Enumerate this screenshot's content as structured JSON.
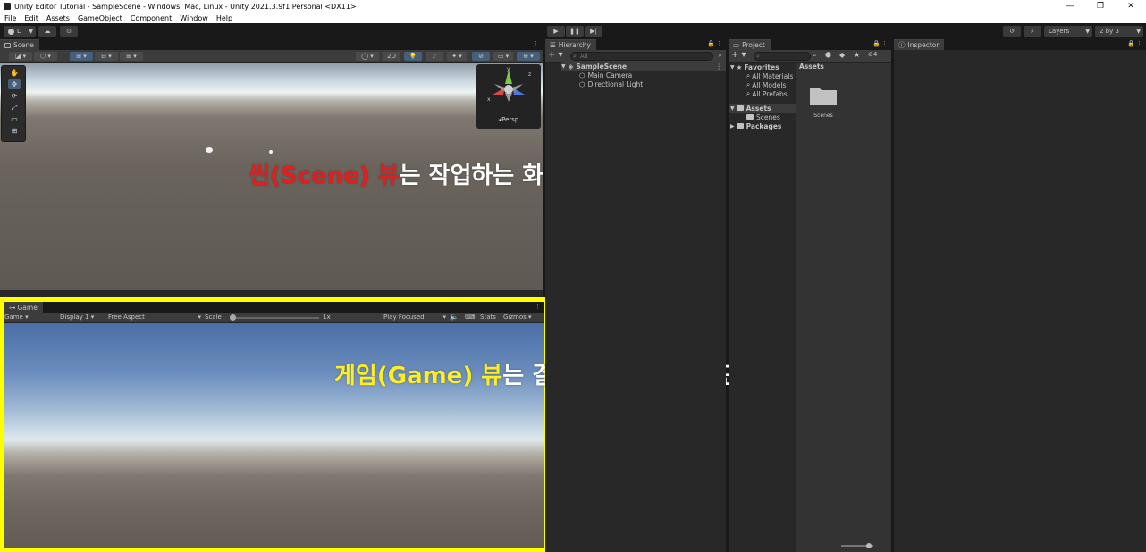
{
  "window": {
    "title": "Unity Editor Tutorial - SampleScene - Windows, Mac, Linux - Unity 2021.3.9f1 Personal <DX11>",
    "controls": [
      "—",
      "❐",
      "✕"
    ]
  },
  "menu": [
    "File",
    "Edit",
    "Assets",
    "GameObject",
    "Component",
    "Window",
    "Help"
  ],
  "toolbar": {
    "account_label": "D",
    "layers_label": "Layers",
    "layout_label": "2 by 3"
  },
  "scene": {
    "tab_label": "Scene",
    "toggle_2d": "2D",
    "projection": "Persp",
    "axes": {
      "y": "y",
      "x": "x",
      "z": "z"
    }
  },
  "game": {
    "tab_label": "Game",
    "mode": "Game",
    "display": "Display 1",
    "aspect": "Free Aspect",
    "scale_label": "Scale",
    "scale_value": "1x",
    "play_mode": "Play Focused",
    "stats": "Stats",
    "gizmos": "Gizmos"
  },
  "hierarchy": {
    "tab_label": "Hierarchy",
    "search_placeholder": "All",
    "scene_name": "SampleScene",
    "items": [
      "Main Camera",
      "Directional Light"
    ]
  },
  "project": {
    "tab_label": "Project",
    "favorites_label": "Favorites",
    "favorites": [
      "All Materials",
      "All Models",
      "All Prefabs"
    ],
    "assets_label": "Assets",
    "assets_children": [
      "Scenes"
    ],
    "packages_label": "Packages",
    "breadcrumb": "Assets",
    "folder_tile": "Scenes",
    "hidden_count": "4"
  },
  "inspector": {
    "tab_label": "Inspector"
  },
  "annotations": {
    "scene_part1": "씬(Scene) 뷰",
    "scene_part2": "는 작업하는 화면",
    "game_part1": "게임(Game) 뷰",
    "game_part2": "는 결과물이 나오는 화면"
  },
  "colors": {
    "highlight_frame": "#ffff00",
    "scene_annot": "#e02020",
    "game_annot": "#ffee22",
    "annot_text": "#ffffff",
    "selected_tool": "#46607c"
  }
}
